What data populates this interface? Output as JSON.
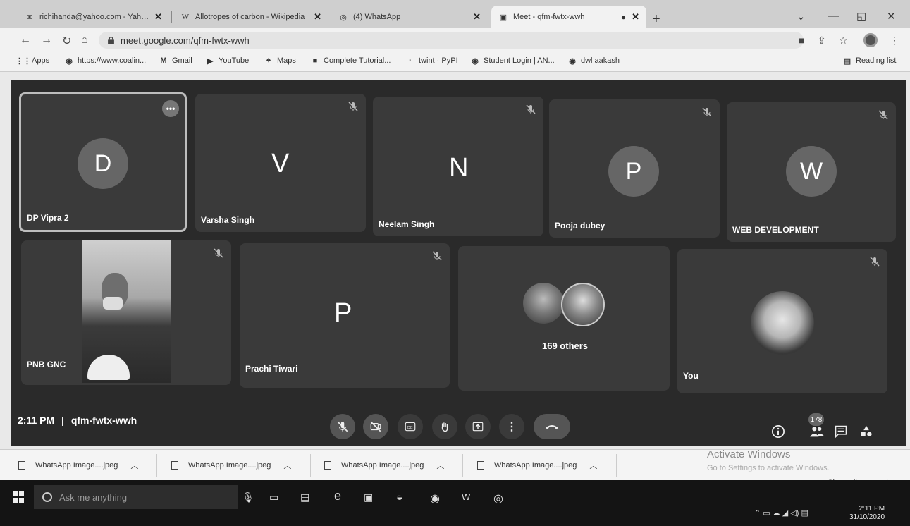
{
  "browser": {
    "tabs": [
      {
        "title": "richihanda@yahoo.com - Yahoo",
        "icon": "mail-icon"
      },
      {
        "title": "Allotropes of carbon - Wikipedia",
        "icon": "wikipedia-icon"
      },
      {
        "title": "(4) WhatsApp",
        "icon": "whatsapp-icon"
      },
      {
        "title": "Meet - qfm-fwtx-wwh",
        "icon": "meet-icon",
        "active": true
      }
    ],
    "url": "meet.google.com/qfm-fwtx-wwh",
    "bookmarks": [
      {
        "label": "Apps"
      },
      {
        "label": "https://www.coalin..."
      },
      {
        "label": "Gmail"
      },
      {
        "label": "YouTube"
      },
      {
        "label": "Maps"
      },
      {
        "label": "Complete Tutorial..."
      },
      {
        "label": "twint · PyPI"
      },
      {
        "label": "Student Login | AN..."
      },
      {
        "label": "dwl aakash"
      }
    ],
    "reading_list": "Reading list"
  },
  "meet": {
    "participants_row1": [
      {
        "name": "DP Vipra 2",
        "initial": "D"
      },
      {
        "name": "Varsha Singh",
        "initial": "V"
      },
      {
        "name": "Neelam Singh",
        "initial": "N"
      },
      {
        "name": "Pooja dubey",
        "initial": "P"
      },
      {
        "name": "WEB DEVELOPMENT",
        "initial": "W"
      }
    ],
    "participants_row2": [
      {
        "name": "PNB GNC"
      },
      {
        "name": "Prachi Tiwari",
        "initial": "P"
      },
      {
        "name": "169 others"
      },
      {
        "name": "You"
      }
    ],
    "time": "2:11 PM",
    "separator": "|",
    "meeting_code": "qfm-fwtx-wwh",
    "participant_count": "178"
  },
  "windows": {
    "activate_title": "Activate Windows",
    "activate_sub": "Go to Settings to activate Windows."
  },
  "downloads": {
    "items": [
      "WhatsApp Image....jpeg",
      "WhatsApp Image....jpeg",
      "WhatsApp Image....jpeg",
      "WhatsApp Image....jpeg"
    ],
    "show_all": "Show all"
  },
  "taskbar": {
    "search_placeholder": "Ask me anything",
    "time": "2:11 PM",
    "date": "31/10/2020"
  }
}
